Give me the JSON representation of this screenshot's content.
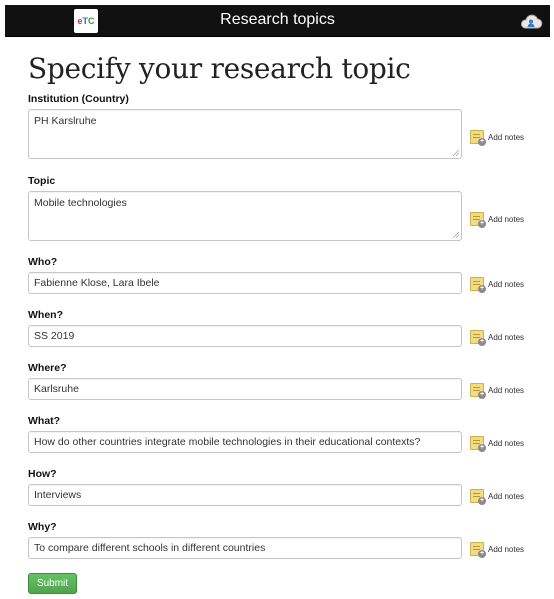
{
  "app": {
    "title": "Research topics",
    "logo_letters": "eTC"
  },
  "page": {
    "heading": "Specify your research topic"
  },
  "notes_label": "Add notes",
  "fields": [
    {
      "label": "Institution (Country)",
      "value": "PH Karslruhe"
    },
    {
      "label": "Topic",
      "value": "Mobile technologies"
    },
    {
      "label": "Who?",
      "value": "Fabienne Klose, Lara Ibele"
    },
    {
      "label": "When?",
      "value": "SS 2019"
    },
    {
      "label": "Where?",
      "value": "Karlsruhe"
    },
    {
      "label": "What?",
      "value": "How do other countries integrate mobile technologies in their educational contexts?"
    },
    {
      "label": "How?",
      "value": "Interviews"
    },
    {
      "label": "Why?",
      "value": "To compare different schools in different countries"
    }
  ],
  "submit_label": "Submit",
  "colors": {
    "header_bg": "#111111",
    "submit_bg": "#5bb75b"
  }
}
